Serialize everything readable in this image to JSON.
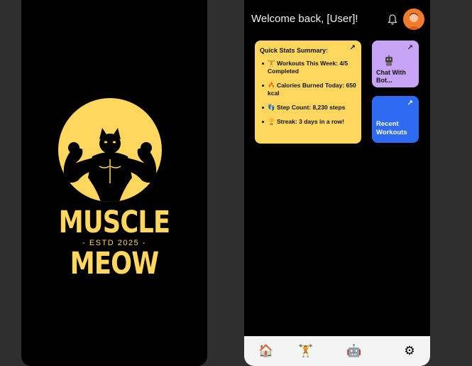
{
  "splash": {
    "logo_top_word": "MUSCLE",
    "logo_tagline": "- ESTD 2025 -",
    "logo_bottom_word": "MEOW",
    "brand_color": "#ffd75f",
    "background_color": "#000000"
  },
  "dashboard": {
    "header": {
      "welcome_text": "Welcome back, [User]!",
      "notification_icon": "bell-icon",
      "avatar_icon": "user-avatar"
    },
    "stats_card": {
      "title": "Quick Stats Summary:",
      "arrow_icon": "↗",
      "items": [
        {
          "icon": "dumbbell-icon",
          "text": "🏋 Workouts This Week: 4/5 Completed"
        },
        {
          "icon": "fire-icon",
          "text": "🔥 Calories Burned Today: 650 kcal"
        },
        {
          "icon": "footprints-icon",
          "text": "👣 Step Count: 8,230 steps"
        },
        {
          "icon": "trophy-icon",
          "text": "🏆 Streak: 3 days in a row!"
        }
      ],
      "color": "#ffd75f"
    },
    "chat_card": {
      "label": "Chat With Bot...",
      "icon": "robot-icon",
      "arrow_icon": "↗",
      "color": "#c7a4f5"
    },
    "workouts_card": {
      "label": "Recent Workouts",
      "arrow_icon": "↗",
      "color": "#2e6bf2"
    },
    "bottom_nav": [
      {
        "name": "home",
        "icon": "🏠"
      },
      {
        "name": "workouts",
        "icon": "🏋"
      },
      {
        "name": "bot",
        "icon": "🤖"
      },
      {
        "name": "settings",
        "icon": "⚙"
      }
    ]
  }
}
